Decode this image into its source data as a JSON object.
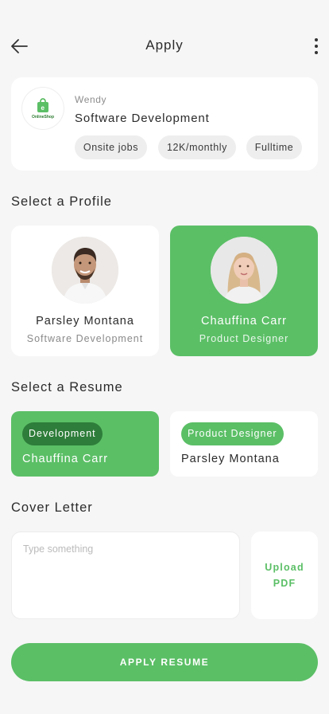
{
  "header": {
    "title": "Apply"
  },
  "job": {
    "logo_text": "OnlineShop",
    "company": "Wendy",
    "title": "Software Development",
    "tags": [
      "Onsite jobs",
      "12K/monthly",
      "Fulltime"
    ]
  },
  "profiles_section": {
    "title": "Select a Profile",
    "items": [
      {
        "name": "Parsley Montana",
        "role": "Software Development",
        "selected": false
      },
      {
        "name": "Chauffina Carr",
        "role": "Product Designer",
        "selected": true
      }
    ]
  },
  "resume_section": {
    "title": "Select a Resume",
    "items": [
      {
        "tag": "Development",
        "name": "Chauffina Carr",
        "selected": true
      },
      {
        "tag": "Product Designer",
        "name": "Parsley Montana",
        "selected": false
      }
    ]
  },
  "cover_letter": {
    "title": "Cover Letter",
    "placeholder": "Type something",
    "value": "",
    "upload_line1": "Upload",
    "upload_line2": "PDF"
  },
  "apply_button": {
    "label": "APPLY RESUME"
  },
  "colors": {
    "accent": "#5bbf66",
    "accent_dark": "#2e7d3a",
    "background": "#f6f6f6"
  },
  "icons": [
    "back-arrow-icon",
    "more-vertical-icon",
    "shopping-bag-icon"
  ]
}
